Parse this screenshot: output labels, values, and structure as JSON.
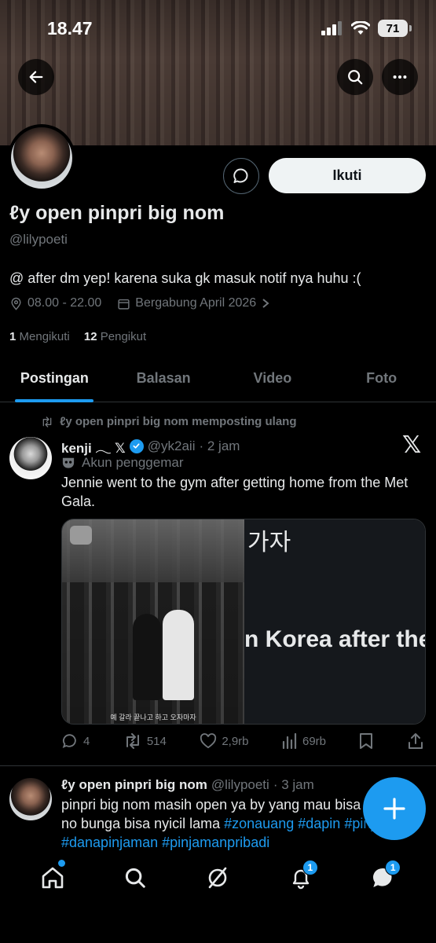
{
  "status_bar": {
    "time": "18.47",
    "battery": "71"
  },
  "profile": {
    "display_name": "ℓy open pinpri big nom",
    "handle": "@lilypoeti",
    "bio": "@ after dm yep! karena suka gk masuk notif nya huhu :(",
    "location": "08.00 - 22.00",
    "joined": "Bergabung April 2026",
    "following_count": "1",
    "following_label": "Mengikuti",
    "followers_count": "12",
    "followers_label": "Pengikut",
    "follow_button": "Ikuti"
  },
  "tabs": [
    {
      "label": "Postingan",
      "active": true
    },
    {
      "label": "Balasan",
      "active": false
    },
    {
      "label": "Video",
      "active": false
    },
    {
      "label": "Foto",
      "active": false
    }
  ],
  "tweets": [
    {
      "repost_line": "ℓy open pinpri big nom memposting ulang",
      "author_name": "kenji 𓂃 𝕏",
      "author_handle": "@yk2aii",
      "time": "· 2 jam",
      "fan_label": "Akun penggemar",
      "text": "Jennie went to the gym after getting home from the Met Gala.",
      "media_text_korean": "가자",
      "media_text_english": "n Korea after the I",
      "media_caption": "예 갈라 끝나고 하고 오자마자",
      "replies": "4",
      "reposts": "514",
      "likes": "2,9rb",
      "views": "69rb"
    },
    {
      "author_name": "ℓy open pinpri big nom",
      "author_handle": "@lilypoeti",
      "time": "· 3 jam",
      "text_plain": "pinpri big nom masih open ya by yang mau bisa yuk cus no bunga bisa nyicil lama ",
      "hashtags": [
        "#zonauang",
        "#dapin",
        "#pinjaman",
        "#danapinjaman",
        "#pinjamanpribadi"
      ]
    }
  ],
  "bottom_nav": {
    "notifications_badge": "1",
    "messages_badge": "1"
  },
  "colors": {
    "accent": "#1d9bf0",
    "background": "#000000",
    "muted": "#71767b"
  }
}
